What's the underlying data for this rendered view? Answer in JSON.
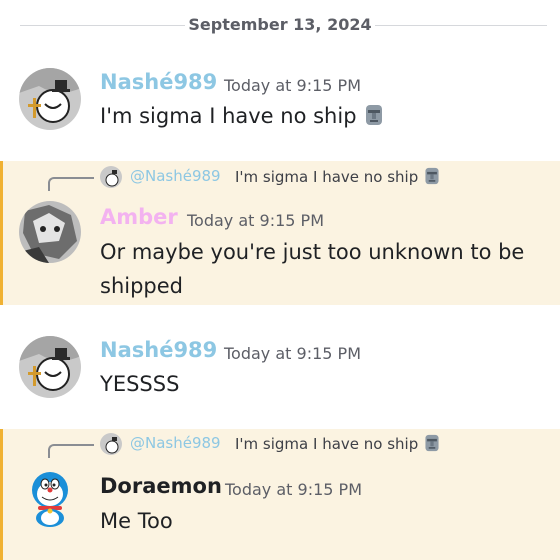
{
  "date_divider": "September 13, 2024",
  "messages": [
    {
      "author": "Nashé989",
      "author_color": "#8dc7e3",
      "time": "Today at 9:15 PM",
      "text": "I'm sigma I have no ship",
      "emoji": "moai-emoji"
    },
    {
      "reply_to": "@Nashé989",
      "reply_text": "I'm sigma I have no ship",
      "author": "Amber",
      "author_color": "#f3b2f0",
      "time": "Today at 9:15 PM",
      "text_line1": "Or maybe you're just too unknown to be",
      "text_line2": "shipped"
    },
    {
      "author": "Nashé989",
      "author_color": "#8dc7e3",
      "time": "Today at 9:15 PM",
      "text": "YESSSS"
    },
    {
      "reply_to": "@Nashé989",
      "reply_text": "I'm sigma I have no ship",
      "author": "Doraemon",
      "author_color": "#1f2124",
      "time": "Today at 9:15 PM",
      "text": "Me Too"
    }
  ],
  "colors": {
    "mention_bg": "#fbf3e1",
    "mention_bar": "#f0b132",
    "timestamp": "#5c5e66"
  }
}
